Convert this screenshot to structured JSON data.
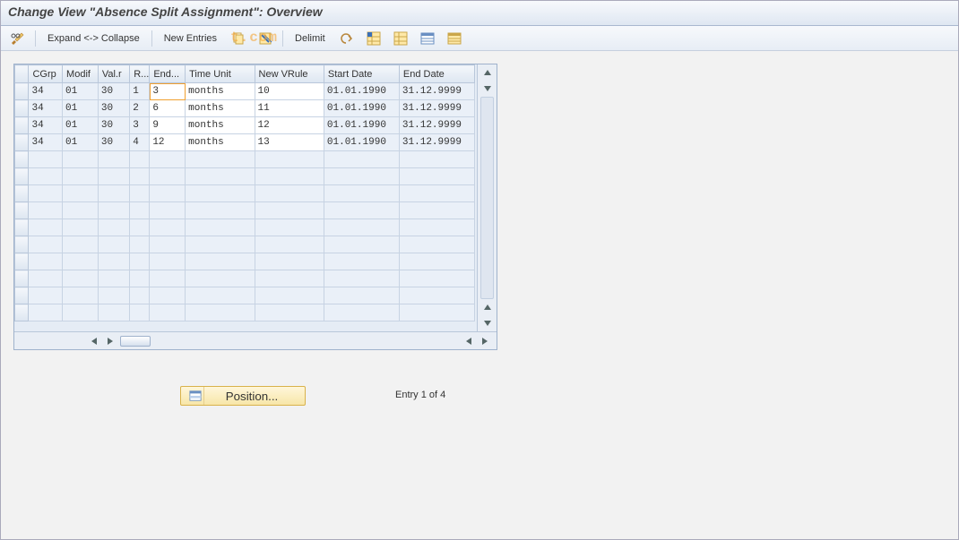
{
  "title": "Change View \"Absence Split Assignment\": Overview",
  "watermark": "t.com",
  "toolbar": {
    "expand_collapse": "Expand <-> Collapse",
    "new_entries": "New Entries",
    "delimit": "Delimit"
  },
  "table": {
    "headers": [
      "CGrp",
      "Modif",
      "Val.r",
      "R...",
      "End...",
      "Time Unit",
      "New VRule",
      "Start Date",
      "End Date"
    ],
    "rows": [
      {
        "cgrp": "34",
        "modif": "01",
        "valr": "30",
        "r": "1",
        "end": "3",
        "tu": "months",
        "vr": "10",
        "sd": "01.01.1990",
        "ed": "31.12.9999"
      },
      {
        "cgrp": "34",
        "modif": "01",
        "valr": "30",
        "r": "2",
        "end": "6",
        "tu": "months",
        "vr": "11",
        "sd": "01.01.1990",
        "ed": "31.12.9999"
      },
      {
        "cgrp": "34",
        "modif": "01",
        "valr": "30",
        "r": "3",
        "end": "9",
        "tu": "months",
        "vr": "12",
        "sd": "01.01.1990",
        "ed": "31.12.9999"
      },
      {
        "cgrp": "34",
        "modif": "01",
        "valr": "30",
        "r": "4",
        "end": "12",
        "tu": "months",
        "vr": "13",
        "sd": "01.01.1990",
        "ed": "31.12.9999"
      }
    ],
    "empty_rows": 10
  },
  "footer": {
    "position_label": "Position...",
    "entry_text": "Entry 1 of 4"
  }
}
